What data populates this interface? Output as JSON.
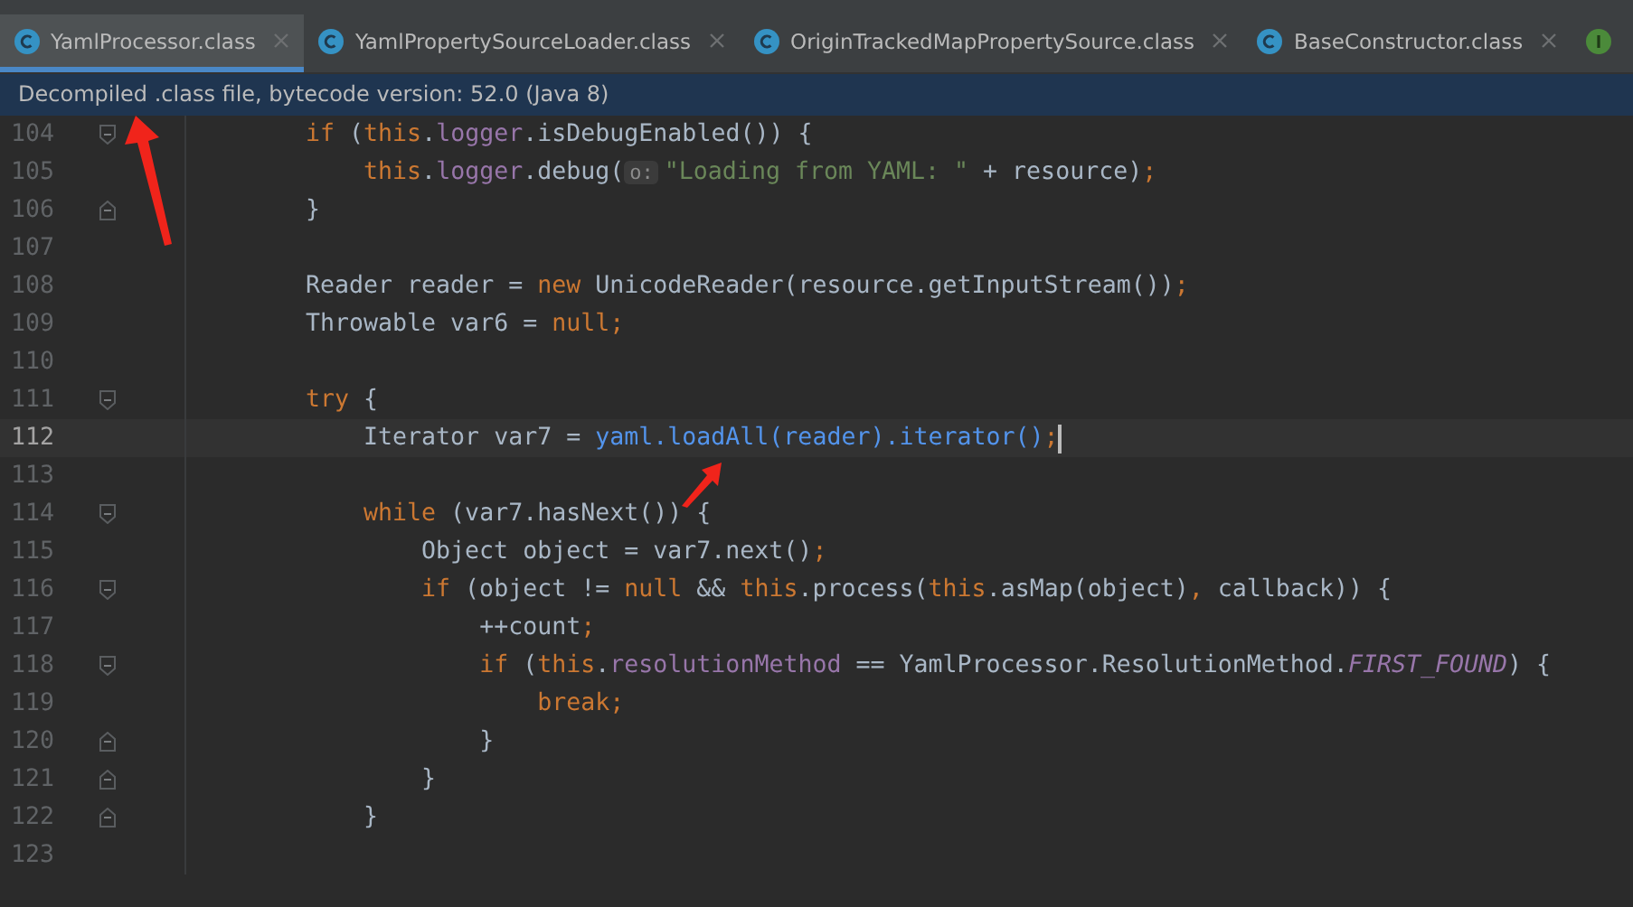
{
  "tabs": [
    {
      "label": "YamlProcessor.class",
      "kind": "class",
      "selected": true
    },
    {
      "label": "YamlPropertySourceLoader.class",
      "kind": "class",
      "selected": false
    },
    {
      "label": "OriginTrackedMapPropertySource.class",
      "kind": "class",
      "selected": false
    },
    {
      "label": "BaseConstructor.class",
      "kind": "class",
      "selected": false
    },
    {
      "kind": "interface",
      "selected": false
    }
  ],
  "notice": "Decompiled .class file, bytecode version: 52.0 (Java 8)",
  "editor": {
    "lines": [
      {
        "number": "104",
        "kind": "fold_start",
        "current": false,
        "tokens": [
          {
            "text": "if",
            "kind": "kw"
          },
          {
            "text": " (",
            "kind": "plain"
          },
          {
            "text": "this",
            "kind": "kw"
          },
          {
            "text": ".",
            "kind": "plain"
          },
          {
            "text": "logger",
            "kind": "field"
          },
          {
            "text": ".isDebugEnabled()) {",
            "kind": "plain"
          }
        ]
      },
      {
        "number": "105",
        "kind": "code",
        "current": false,
        "tokens": [
          {
            "text": "this",
            "kind": "kw"
          },
          {
            "text": ".",
            "kind": "plain"
          },
          {
            "text": "logger",
            "kind": "field"
          },
          {
            "text": ".debug(",
            "kind": "plain"
          },
          {
            "text": "o:",
            "kind": "hint"
          },
          {
            "text": "\"Loading from YAML: \"",
            "kind": "str"
          },
          {
            "text": " + resource)",
            "kind": "plain"
          },
          {
            "text": ";",
            "kind": "kw"
          }
        ]
      },
      {
        "number": "106",
        "kind": "fold_end",
        "current": false,
        "tokens": [
          {
            "text": "}",
            "kind": "plain"
          }
        ]
      },
      {
        "number": "107",
        "kind": "code",
        "current": false
      },
      {
        "number": "108",
        "kind": "code",
        "current": false,
        "tokens": [
          {
            "text": "Reader reader = ",
            "kind": "plain"
          },
          {
            "text": "new",
            "kind": "kw"
          },
          {
            "text": " UnicodeReader(resource.getInputStream())",
            "kind": "plain"
          },
          {
            "text": ";",
            "kind": "kw"
          }
        ]
      },
      {
        "number": "109",
        "kind": "code",
        "current": false,
        "tokens": [
          {
            "text": "Throwable var6 = ",
            "kind": "plain"
          },
          {
            "text": "null;",
            "kind": "kw"
          }
        ]
      },
      {
        "number": "110",
        "kind": "code",
        "current": false
      },
      {
        "number": "111",
        "kind": "fold_start",
        "current": false,
        "tokens": [
          {
            "text": "try",
            "kind": "kw"
          },
          {
            "text": " {",
            "kind": "plain"
          }
        ]
      },
      {
        "number": "112",
        "kind": "code",
        "current": true,
        "tokens": [
          {
            "text": "Iterator var7 = ",
            "kind": "plain"
          },
          {
            "text": "yaml.loadAll(reader).iterator()",
            "kind": "method"
          },
          {
            "text": ";",
            "kind": "kw"
          }
        ]
      },
      {
        "number": "113",
        "kind": "code",
        "current": false
      },
      {
        "number": "114",
        "kind": "fold_start",
        "current": false,
        "tokens": [
          {
            "text": "while",
            "kind": "kw"
          },
          {
            "text": " (var7.hasNext()) {",
            "kind": "plain"
          }
        ]
      },
      {
        "number": "115",
        "kind": "code",
        "current": false,
        "tokens": [
          {
            "text": "Object object = var7.next()",
            "kind": "plain"
          },
          {
            "text": ";",
            "kind": "kw"
          }
        ]
      },
      {
        "number": "116",
        "kind": "fold_start",
        "current": false,
        "tokens": [
          {
            "text": "if",
            "kind": "kw"
          },
          {
            "text": " (object != ",
            "kind": "plain"
          },
          {
            "text": "null",
            "kind": "kw"
          },
          {
            "text": " && ",
            "kind": "plain"
          },
          {
            "text": "this",
            "kind": "kw"
          },
          {
            "text": ".process(",
            "kind": "plain"
          },
          {
            "text": "this",
            "kind": "kw"
          },
          {
            "text": ".asMap(object)",
            "kind": "plain"
          },
          {
            "text": ",",
            "kind": "kw"
          },
          {
            "text": " callback)) {",
            "kind": "plain"
          }
        ]
      },
      {
        "number": "117",
        "kind": "code",
        "current": false,
        "tokens": [
          {
            "text": "++count",
            "kind": "plain"
          },
          {
            "text": ";",
            "kind": "kw"
          }
        ]
      },
      {
        "number": "118",
        "kind": "fold_start",
        "current": false,
        "tokens": [
          {
            "text": "if",
            "kind": "kw"
          },
          {
            "text": " (",
            "kind": "plain"
          },
          {
            "text": "this",
            "kind": "kw"
          },
          {
            "text": ".",
            "kind": "plain"
          },
          {
            "text": "resolutionMethod",
            "kind": "field"
          },
          {
            "text": " == YamlProcessor.ResolutionMethod.",
            "kind": "plain"
          },
          {
            "text": "FIRST_FOUND",
            "kind": "const"
          },
          {
            "text": ") {",
            "kind": "plain"
          }
        ]
      },
      {
        "number": "119",
        "kind": "code",
        "current": false,
        "tokens": [
          {
            "text": "break;",
            "kind": "kw"
          }
        ]
      },
      {
        "number": "120",
        "kind": "fold_end",
        "current": false,
        "tokens": [
          {
            "text": "}",
            "kind": "plain"
          }
        ]
      },
      {
        "number": "121",
        "kind": "fold_end",
        "current": false,
        "tokens": [
          {
            "text": "}",
            "kind": "plain"
          }
        ]
      },
      {
        "number": "122",
        "kind": "fold_end",
        "current": false,
        "tokens": [
          {
            "text": "}",
            "kind": "plain"
          }
        ]
      },
      {
        "number": "123",
        "kind": "code",
        "current": false
      }
    ]
  }
}
